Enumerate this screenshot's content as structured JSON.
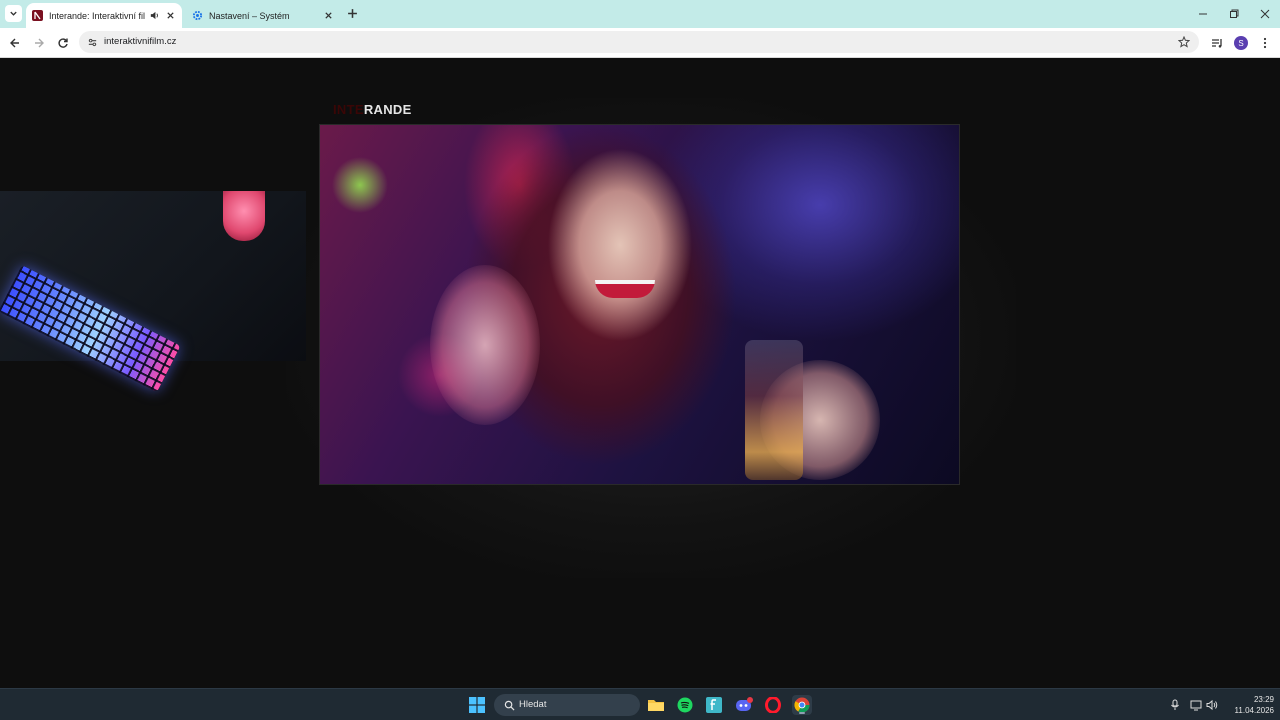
{
  "browser": {
    "tabs": [
      {
        "title": "Interande: Interaktivní film",
        "active": true,
        "audio": true
      },
      {
        "title": "Nastavení – Systém",
        "active": false,
        "audio": false
      }
    ],
    "url": "interaktivnifilm.cz",
    "profile_initial": "S"
  },
  "page": {
    "logo_prefix": "INTE",
    "logo_main": "RANDE"
  },
  "taskbar": {
    "search_placeholder": "Hledat",
    "time": "23:29",
    "date": "11.04.2026"
  },
  "colors": {
    "tabstrip": "#c3ebe8",
    "page_bg": "#0e0e0e",
    "taskbar": "#1f2a33",
    "logo_accent": "#3a0606"
  }
}
